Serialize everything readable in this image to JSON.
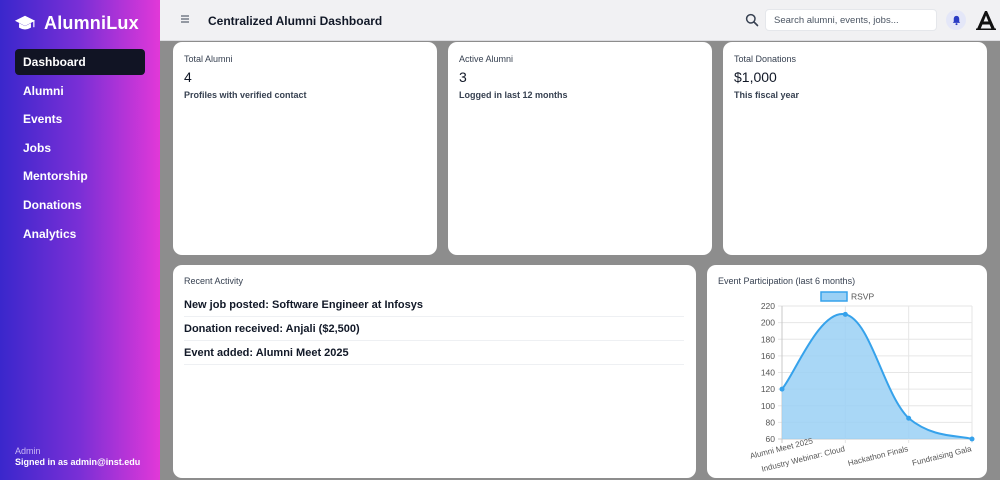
{
  "brand": {
    "name": "AlumniLux",
    "icon": "graduation-cap-icon"
  },
  "nav": [
    {
      "label": "Dashboard",
      "active": true
    },
    {
      "label": "Alumni"
    },
    {
      "label": "Events"
    },
    {
      "label": "Jobs"
    },
    {
      "label": "Mentorship"
    },
    {
      "label": "Donations"
    },
    {
      "label": "Analytics"
    }
  ],
  "sidebar_footer": {
    "role": "Admin",
    "signed_in": "Signed in as admin@inst.edu"
  },
  "header": {
    "title": "Centralized Alumni Dashboard",
    "search_placeholder": "Search alumni, events, jobs...",
    "icons": [
      "hamburger-menu-icon",
      "search-icon",
      "bell-icon",
      "logo-avatar"
    ]
  },
  "stats": [
    {
      "label": "Total Alumni",
      "value": "4",
      "sub": "Profiles with verified contact"
    },
    {
      "label": "Active Alumni",
      "value": "3",
      "sub": "Logged in last 12 months"
    },
    {
      "label": "Total Donations",
      "value": "$1,000",
      "sub": "This fiscal year"
    }
  ],
  "activity": {
    "title": "Recent Activity",
    "items": [
      "New job posted: Software Engineer at Infosys",
      "Donation received: Anjali ($2,500)",
      "Event added: Alumni Meet 2025"
    ]
  },
  "chart_data": {
    "type": "area",
    "title": "Event Participation (last 6 months)",
    "categories": [
      "Alumni Meet 2025",
      "Industry Webinar: Cloud",
      "Hackathon Finals",
      "Fundraising Gala"
    ],
    "series": [
      {
        "name": "RSVP",
        "values": [
          120,
          210,
          85,
          60
        ]
      }
    ],
    "ylim": [
      60,
      220
    ],
    "yticks": [
      60,
      80,
      100,
      120,
      140,
      160,
      180,
      200,
      220
    ],
    "grid": true,
    "legend": "top",
    "colors": {
      "line": "#36a2eb",
      "fill": "#9ad0f5"
    }
  },
  "colors": {
    "sidebar_start": "#3a27cc",
    "sidebar_end": "#e238d8",
    "active_nav": "#111424"
  }
}
